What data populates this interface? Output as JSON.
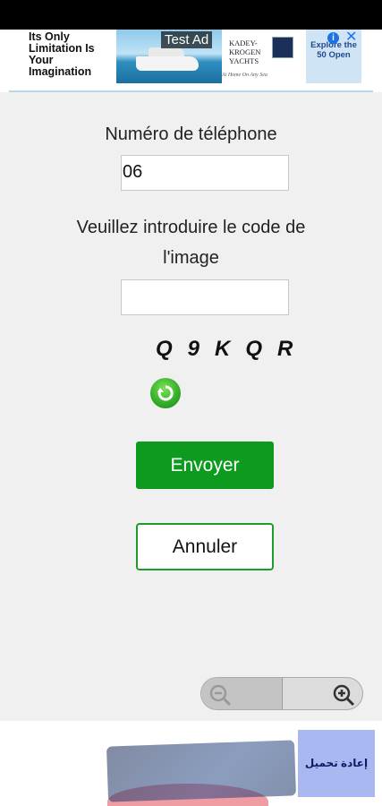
{
  "top_ad": {
    "slogan": "Its Only Limitation Is Your Imagination",
    "test_label": "Test Ad",
    "brand_line1": "KADEY-",
    "brand_line2": "KROGEN",
    "brand_line3": "YACHTS",
    "brand_tagline": "At Home On Any Sea",
    "cta": "Explore the 50 Open"
  },
  "form": {
    "phone_label": "Numéro de téléphone",
    "phone_value": "06",
    "code_label_line1": "Veuillez introduire le code de",
    "code_label_line2": "l'image",
    "code_value": "",
    "captcha_chars": [
      "Q",
      "9",
      "K",
      "Q",
      "R"
    ],
    "submit_label": "Envoyer",
    "cancel_label": "Annuler"
  },
  "bottom_ad": {
    "cta": "إعادة تحميل"
  },
  "colors": {
    "submit_bg": "#0c9b1e",
    "cancel_border": "#1f9b2a",
    "page_bg": "#f0f0f0"
  }
}
